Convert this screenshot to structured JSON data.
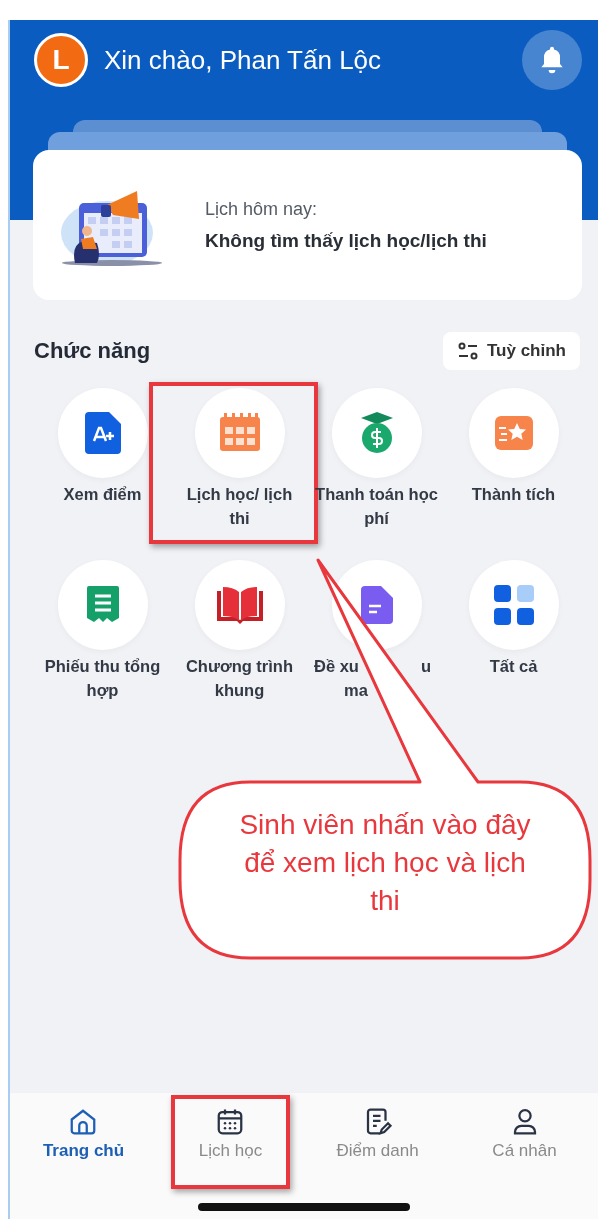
{
  "header": {
    "avatar_initial": "L",
    "greeting": "Xin chào, Phan Tấn Lộc"
  },
  "today_card": {
    "label": "Lịch hôm nay:",
    "message": "Không tìm thấy lịch học/lịch thi"
  },
  "section": {
    "title": "Chức năng",
    "customize_button": "Tuỳ chỉnh"
  },
  "functions": [
    {
      "kind": "grade",
      "label": "Xem điểm",
      "highlighted": false
    },
    {
      "kind": "calendar",
      "label": "Lịch học/ lịch thi",
      "highlighted": true
    },
    {
      "kind": "fee",
      "label": "Thanh toán học phí",
      "highlighted": false
    },
    {
      "kind": "award",
      "label": "Thành tích",
      "highlighted": false
    },
    {
      "kind": "receipt",
      "label": "Phiếu thu tổng hợp",
      "highlighted": false
    },
    {
      "kind": "book",
      "label": "Chương trình khung",
      "highlighted": false
    },
    {
      "kind": "request",
      "label_fragments": [
        [
          "Đề xu",
          "u"
        ],
        [
          "ma"
        ]
      ],
      "highlighted": false
    },
    {
      "kind": "all",
      "label": "Tất cả",
      "highlighted": false
    }
  ],
  "callout": {
    "text": "Sinh viên nhấn vào đây để xem lịch học và lịch thi"
  },
  "bottom_nav": [
    {
      "kind": "home",
      "label": "Trang chủ",
      "selected": true,
      "highlighted": false
    },
    {
      "kind": "calendar",
      "label": "Lịch học",
      "selected": false,
      "highlighted": true
    },
    {
      "kind": "attendance",
      "label": "Điểm danh",
      "selected": false,
      "highlighted": false
    },
    {
      "kind": "person",
      "label": "Cá nhân",
      "selected": false,
      "highlighted": false
    }
  ]
}
